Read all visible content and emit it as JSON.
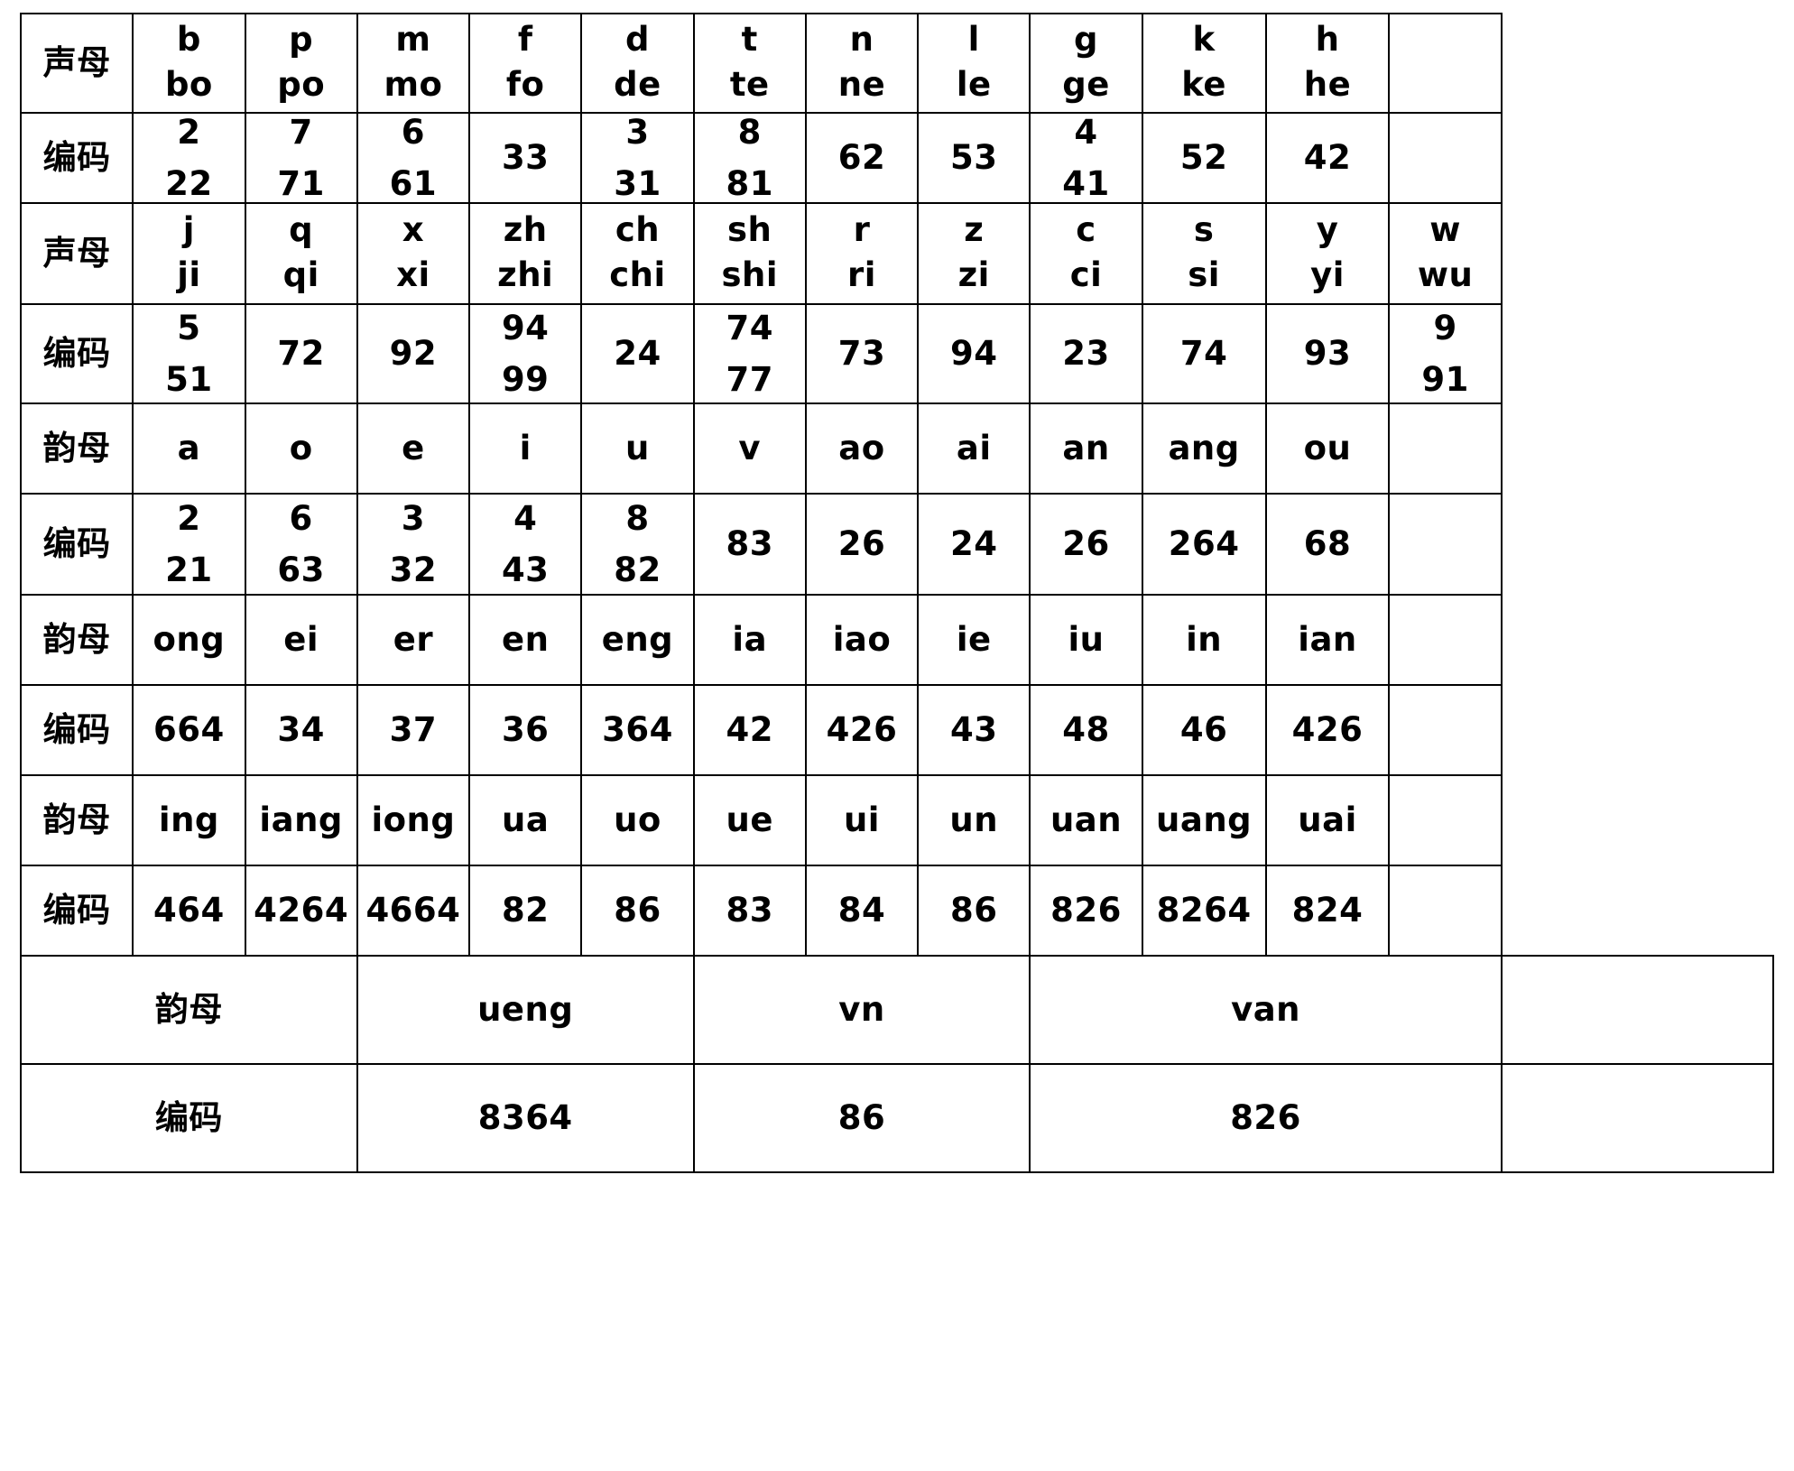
{
  "labels": {
    "initial": "声母",
    "code": "编码",
    "final": "韵母"
  },
  "table": {
    "rows": [
      {
        "kind": "initials",
        "label": "声母",
        "cells": [
          {
            "l1": "b",
            "l2": "bo"
          },
          {
            "l1": "p",
            "l2": "po"
          },
          {
            "l1": "m",
            "l2": "mo"
          },
          {
            "l1": "f",
            "l2": "fo"
          },
          {
            "l1": "d",
            "l2": "de"
          },
          {
            "l1": "t",
            "l2": "te"
          },
          {
            "l1": "n",
            "l2": "ne"
          },
          {
            "l1": "l",
            "l2": "le"
          },
          {
            "l1": "g",
            "l2": "ge"
          },
          {
            "l1": "k",
            "l2": "ke"
          },
          {
            "l1": "h",
            "l2": "he"
          }
        ],
        "tail": null
      },
      {
        "kind": "codes",
        "label": "编码",
        "cells": [
          {
            "l1": "2",
            "l2": "22"
          },
          {
            "l1": "7",
            "l2": "71"
          },
          {
            "l1": "6",
            "l2": "61"
          },
          {
            "l1": "33",
            "l2": ""
          },
          {
            "l1": "3",
            "l2": "31"
          },
          {
            "l1": "8",
            "l2": "81"
          },
          {
            "l1": "62",
            "l2": ""
          },
          {
            "l1": "53",
            "l2": ""
          },
          {
            "l1": "4",
            "l2": "41"
          },
          {
            "l1": "52",
            "l2": ""
          },
          {
            "l1": "42",
            "l2": ""
          }
        ],
        "tail": null
      },
      {
        "kind": "initials",
        "label": "声母",
        "cells": [
          {
            "l1": "j",
            "l2": "ji"
          },
          {
            "l1": "q",
            "l2": "qi"
          },
          {
            "l1": "x",
            "l2": "xi"
          },
          {
            "l1": "zh",
            "l2": "zhi"
          },
          {
            "l1": "ch",
            "l2": "chi"
          },
          {
            "l1": "sh",
            "l2": "shi"
          },
          {
            "l1": "r",
            "l2": "ri"
          },
          {
            "l1": "z",
            "l2": "zi"
          },
          {
            "l1": "c",
            "l2": "ci"
          },
          {
            "l1": "s",
            "l2": "si"
          },
          {
            "l1": "y",
            "l2": "yi"
          }
        ],
        "tail": {
          "l1": "w",
          "l2": "wu"
        }
      },
      {
        "kind": "codes",
        "label": "编码",
        "cells": [
          {
            "l1": "5",
            "l2": "51"
          },
          {
            "l1": "72",
            "l2": ""
          },
          {
            "l1": "92",
            "l2": ""
          },
          {
            "l1": "94",
            "l2": "99"
          },
          {
            "l1": "24",
            "l2": ""
          },
          {
            "l1": "74",
            "l2": "77"
          },
          {
            "l1": "73",
            "l2": ""
          },
          {
            "l1": "94",
            "l2": ""
          },
          {
            "l1": "23",
            "l2": ""
          },
          {
            "l1": "74",
            "l2": ""
          },
          {
            "l1": "93",
            "l2": ""
          }
        ],
        "tail": {
          "l1": "9",
          "l2": "91"
        }
      },
      {
        "kind": "finals",
        "label": "韵母",
        "cells": [
          {
            "l1": "a",
            "l2": ""
          },
          {
            "l1": "o",
            "l2": ""
          },
          {
            "l1": "e",
            "l2": ""
          },
          {
            "l1": "i",
            "l2": ""
          },
          {
            "l1": "u",
            "l2": ""
          },
          {
            "l1": "v",
            "l2": ""
          },
          {
            "l1": "ao",
            "l2": ""
          },
          {
            "l1": "ai",
            "l2": ""
          },
          {
            "l1": "an",
            "l2": ""
          },
          {
            "l1": "ang",
            "l2": ""
          },
          {
            "l1": "ou",
            "l2": ""
          }
        ],
        "tail": null
      },
      {
        "kind": "codes",
        "label": "编码",
        "cells": [
          {
            "l1": "2",
            "l2": "21"
          },
          {
            "l1": "6",
            "l2": "63"
          },
          {
            "l1": "3",
            "l2": "32"
          },
          {
            "l1": "4",
            "l2": "43"
          },
          {
            "l1": "8",
            "l2": "82"
          },
          {
            "l1": "83",
            "l2": ""
          },
          {
            "l1": "26",
            "l2": ""
          },
          {
            "l1": "24",
            "l2": ""
          },
          {
            "l1": "26",
            "l2": ""
          },
          {
            "l1": "264",
            "l2": ""
          },
          {
            "l1": "68",
            "l2": ""
          }
        ],
        "tail": null
      },
      {
        "kind": "finals",
        "label": "韵母",
        "cells": [
          {
            "l1": "ong",
            "l2": ""
          },
          {
            "l1": "ei",
            "l2": ""
          },
          {
            "l1": "er",
            "l2": ""
          },
          {
            "l1": "en",
            "l2": ""
          },
          {
            "l1": "eng",
            "l2": ""
          },
          {
            "l1": "ia",
            "l2": ""
          },
          {
            "l1": "iao",
            "l2": ""
          },
          {
            "l1": "ie",
            "l2": ""
          },
          {
            "l1": "iu",
            "l2": ""
          },
          {
            "l1": "in",
            "l2": ""
          },
          {
            "l1": "ian",
            "l2": ""
          }
        ],
        "tail": null
      },
      {
        "kind": "codes",
        "label": "编码",
        "cells": [
          {
            "l1": "664",
            "l2": ""
          },
          {
            "l1": "34",
            "l2": ""
          },
          {
            "l1": "37",
            "l2": ""
          },
          {
            "l1": "36",
            "l2": ""
          },
          {
            "l1": "364",
            "l2": ""
          },
          {
            "l1": "42",
            "l2": ""
          },
          {
            "l1": "426",
            "l2": ""
          },
          {
            "l1": "43",
            "l2": ""
          },
          {
            "l1": "48",
            "l2": ""
          },
          {
            "l1": "46",
            "l2": ""
          },
          {
            "l1": "426",
            "l2": ""
          }
        ],
        "tail": null
      },
      {
        "kind": "finals",
        "label": "韵母",
        "cells": [
          {
            "l1": "ing",
            "l2": ""
          },
          {
            "l1": "iang",
            "l2": ""
          },
          {
            "l1": "iong",
            "l2": ""
          },
          {
            "l1": "ua",
            "l2": ""
          },
          {
            "l1": "uo",
            "l2": ""
          },
          {
            "l1": "ue",
            "l2": ""
          },
          {
            "l1": "ui",
            "l2": ""
          },
          {
            "l1": "un",
            "l2": ""
          },
          {
            "l1": "uan",
            "l2": ""
          },
          {
            "l1": "uang",
            "l2": ""
          },
          {
            "l1": "uai",
            "l2": ""
          }
        ],
        "tail": null
      },
      {
        "kind": "codes",
        "label": "编码",
        "cells": [
          {
            "l1": "464",
            "l2": ""
          },
          {
            "l1": "4264",
            "l2": ""
          },
          {
            "l1": "4664",
            "l2": ""
          },
          {
            "l1": "82",
            "l2": ""
          },
          {
            "l1": "86",
            "l2": ""
          },
          {
            "l1": "83",
            "l2": ""
          },
          {
            "l1": "84",
            "l2": ""
          },
          {
            "l1": "86",
            "l2": ""
          },
          {
            "l1": "826",
            "l2": ""
          },
          {
            "l1": "8264",
            "l2": ""
          },
          {
            "l1": "824",
            "l2": ""
          }
        ],
        "tail": null
      }
    ],
    "wide_rows": [
      {
        "kind": "finals",
        "label": "韵母",
        "cells": [
          "ueng",
          "vn",
          "van"
        ]
      },
      {
        "kind": "codes",
        "label": "编码",
        "cells": [
          "8364",
          "86",
          "826"
        ]
      }
    ]
  }
}
